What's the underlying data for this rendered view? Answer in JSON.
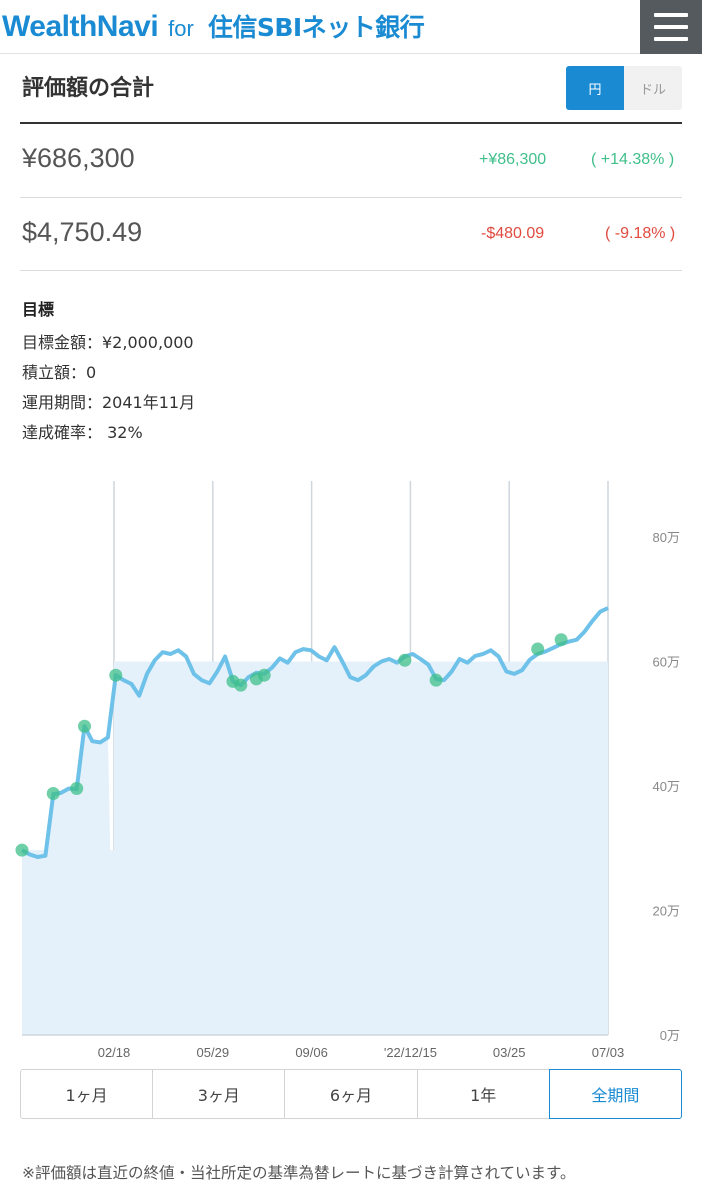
{
  "header": {
    "brand_name": "WealthNavi",
    "brand_for": "for",
    "brand_bank": "住信SBIネット銀行",
    "menu_icon": "hamburger-menu-icon",
    "accent_color": "#1a8bd2"
  },
  "summary": {
    "title": "評価額の合計",
    "currency_toggle": {
      "yen_label": "円",
      "dollar_label": "ドル",
      "selected": "円"
    },
    "yen": {
      "value": "¥686,300",
      "change": "+¥86,300",
      "change_pct": "( +14.38% )"
    },
    "usd": {
      "value": "$4,750.49",
      "change": "-$480.09",
      "change_pct": "( -9.18% )"
    }
  },
  "goal": {
    "heading": "目標",
    "target_amount": "目標金額：¥2,000,000",
    "monthly_contribution": "積立額：0",
    "period": "運用期間：2041年11月",
    "achievement_rate": "達成確率： 32%"
  },
  "chart_data": {
    "type": "line",
    "title": "",
    "xlabel": "",
    "ylabel": "",
    "y_unit": "万",
    "ylim": [
      0,
      80
    ],
    "y_ticks": [
      "0万",
      "20万",
      "40万",
      "60万",
      "80万"
    ],
    "x_ticks": [
      "02/18",
      "05/29",
      "09/06",
      "'22/12/15",
      "03/25",
      "07/03"
    ],
    "grid": "vertical",
    "series": [
      {
        "values": [
          29.7,
          29.0,
          28.6,
          28.8,
          38.7,
          38.9,
          39.6,
          39.5,
          49.6,
          47.2,
          47.0,
          47.8,
          57.8,
          57.0,
          56.4,
          54.5,
          58.0,
          60.2,
          61.5,
          61.2,
          61.8,
          60.8,
          58.0,
          57.0,
          56.5,
          58.4,
          60.8,
          56.8,
          56.2,
          57.5,
          58.2,
          58.0,
          59.0,
          60.5,
          59.8,
          61.5,
          62.0,
          61.8,
          60.8,
          60.2,
          62.3,
          60.0,
          57.5,
          57.0,
          57.8,
          59.2,
          60.0,
          60.4,
          59.8,
          60.8,
          61.2,
          60.4,
          59.5,
          57.2,
          57.0,
          58.4,
          60.4,
          59.8,
          60.9,
          61.2,
          61.8,
          60.8,
          58.4,
          58.0,
          58.6,
          60.3,
          61.2,
          61.6,
          62.2,
          62.8,
          63.2,
          63.5,
          64.8,
          66.5,
          68.0,
          68.6
        ],
        "color": "#6ec1e8"
      }
    ],
    "baseline_area": {
      "value": 60.0,
      "color": "#e4f1fa"
    },
    "contribution_points": [
      29.7,
      38.8,
      39.6,
      49.6,
      57.8,
      56.8,
      56.2,
      57.2,
      57.8,
      60.2,
      57.0,
      62.0,
      63.5
    ],
    "contribution_point_color": "#3fbf8a"
  },
  "periods": {
    "options": [
      "1ヶ月",
      "3ヶ月",
      "6ヶ月",
      "1年",
      "全期間"
    ],
    "selected": "全期間"
  },
  "footnote": "※評価額は直近の終値・当社所定の基準為替レートに基づき計算されています。"
}
